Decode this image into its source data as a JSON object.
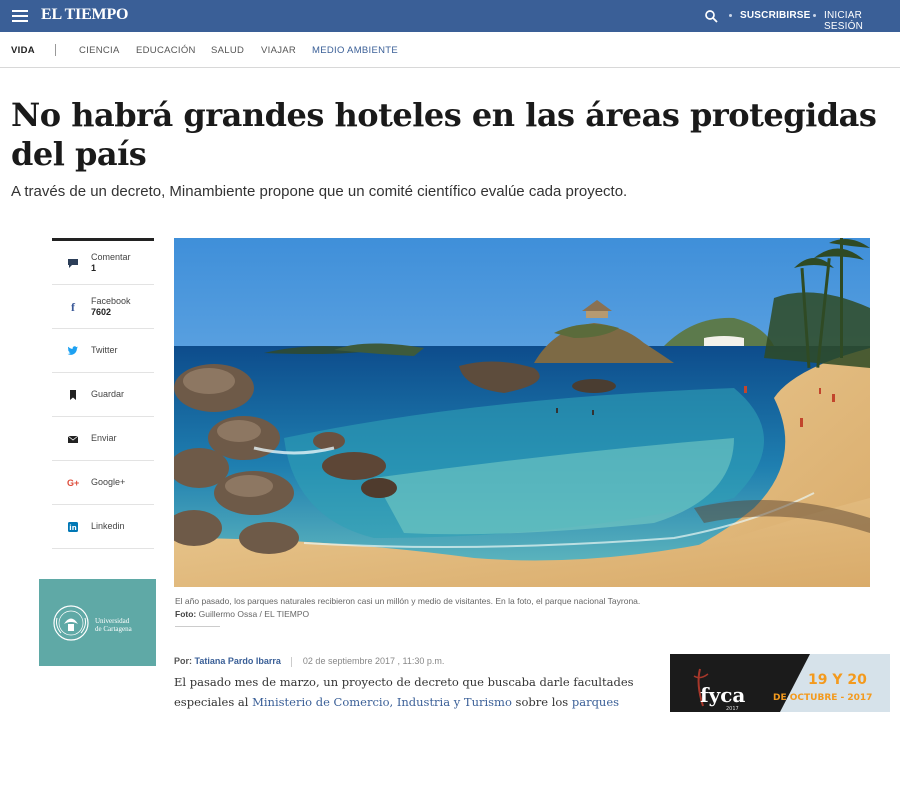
{
  "header": {
    "logo": "EL TIEMPO",
    "subscribe": "SUSCRIBIRSE",
    "login": "INICIAR SESIÓN",
    "menu_icon": "hamburger-menu-icon",
    "search_icon": "search-icon",
    "bg_color": "#3a5f97"
  },
  "section_nav": {
    "current": "VIDA",
    "items": [
      "CIENCIA",
      "EDUCACIÓN",
      "SALUD",
      "VIAJAR",
      "MEDIO AMBIENTE"
    ]
  },
  "article": {
    "headline": "No habrá grandes hoteles en las áreas protegidas del país",
    "lead": "A través de un decreto, Minambiente propone que un comité científico evalúe cada proyecto.",
    "caption": "El año pasado, los parques naturales recibieron casi un millón y medio de visitantes. En la foto, el parque nacional Tayrona.",
    "photo_credit_label": "Foto:",
    "photo_credit": "Guillermo Ossa / EL TIEMPO",
    "byline_label": "Por:",
    "author": "Tatiana Pardo Ibarra",
    "date": "02 de septiembre 2017 , 11:30 p.m.",
    "body": {
      "part1": "El pasado mes de marzo, un proyecto de decreto que buscaba darle facultades especiales al ",
      "link1": "Ministerio de Comercio, Industria y Turismo",
      "part2": " sobre los ",
      "link2": "parques"
    }
  },
  "share": [
    {
      "label": "Comentar",
      "count": "1",
      "icon": "comment-icon"
    },
    {
      "label": "Facebook",
      "count": "7602",
      "icon": "facebook-icon"
    },
    {
      "label": "Twitter",
      "icon": "twitter-icon"
    },
    {
      "label": "Guardar",
      "icon": "bookmark-icon"
    },
    {
      "label": "Enviar",
      "icon": "mail-icon"
    },
    {
      "label": "Google+",
      "icon": "google-plus-icon"
    },
    {
      "label": "Linkedin",
      "icon": "linkedin-icon"
    }
  ],
  "promo": {
    "name_line1": "Universidad",
    "name_line2": "de Cartagena",
    "color": "#5fa9a6"
  },
  "ad": {
    "brand": "fyca",
    "year": "2017",
    "date_big": "19 Y 20",
    "date_small": "DE OCTUBRE - 2017",
    "accent": "#f39a1e"
  }
}
